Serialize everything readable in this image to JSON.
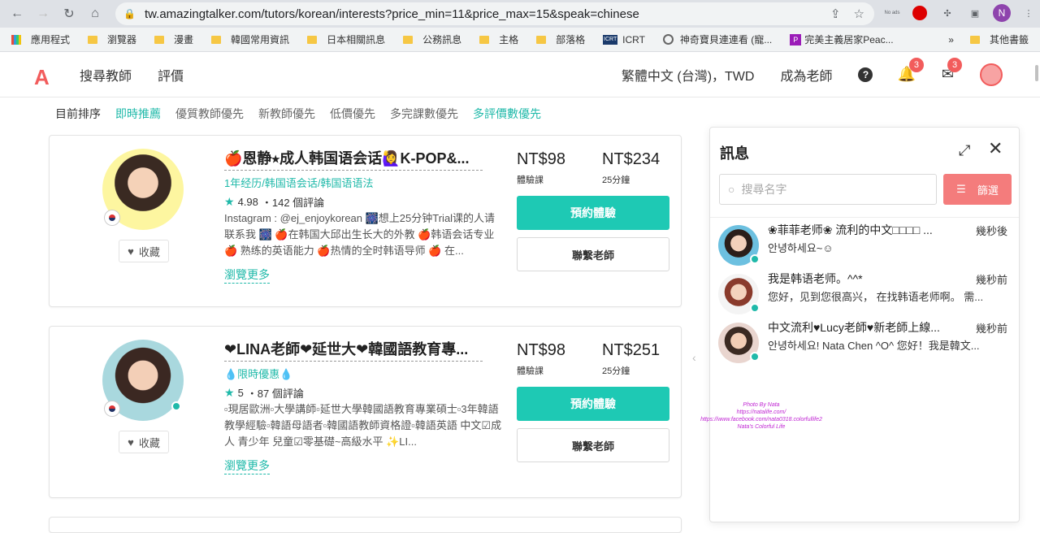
{
  "browser": {
    "url": "tw.amazingtalker.com/tutors/korean/interests?price_min=11&price_max=15&speak=chinese",
    "profile_initial": "N",
    "ext_label": "No ads"
  },
  "bookmarks": {
    "items": [
      "應用程式",
      "瀏覽器",
      "漫畫",
      "韓國常用資訊",
      "日本相關訊息",
      "公務訊息",
      "主格",
      "部落格",
      "ICRT",
      "神奇寶貝連連看 (寵...",
      "完美主義居家Peac..."
    ],
    "more": "»",
    "other": "其他書籤"
  },
  "header": {
    "logo": "A",
    "nav": [
      "搜尋教師",
      "評價"
    ],
    "language": "繁體中文 (台灣)，TWD",
    "become_teacher": "成為老師",
    "help": "?",
    "notif_count": "3",
    "mail_count": "3"
  },
  "sort": {
    "label": "目前排序",
    "options": [
      "即時推薦",
      "優質教師優先",
      "新教師優先",
      "低價優先",
      "多完課數優先",
      "多評價數優先"
    ]
  },
  "tutors": [
    {
      "name": "🍎恩静⭑成人韩国语会话🙋‍♀K-POP&...",
      "tag": "1年经历/韩国语会话/韩国语语法",
      "rating": "4.98",
      "reviews": "・142 個評論",
      "desc": "Instagram : @ej_enjoykorean 🎆想上25分钟Trial课的人请联系我 🎆 🍎在韩国大邱出生长大的外教 🍎韩语会话专业 🍎 熟练的英语能力 🍎热情的全时韩语导师 🍎 在...",
      "more": "瀏覽更多",
      "trial_price": "NT$98",
      "trial_label": "體驗課",
      "price": "NT$234",
      "price_label": "25分鐘",
      "book": "預約體驗",
      "contact": "聯繫老師",
      "fav": "收藏"
    },
    {
      "name": "❤LINA老師❤延世大❤韓國語教育專...",
      "tag": "💧限時優惠💧",
      "rating": "5",
      "reviews": "・87 個評論",
      "desc": "▫現居歐洲▫大學講師▫延世大學韓國語教育專業碩士▫3年韓語教學經驗▫韓語母語者▫韓國語教師資格證▫韓語英語 中文☑成人 青少年 兒童☑零基礎~高級水平 ✨LI...",
      "more": "瀏覽更多",
      "trial_price": "NT$98",
      "trial_label": "體驗課",
      "price": "NT$251",
      "price_label": "25分鐘",
      "book": "預約體驗",
      "contact": "聯繫老師",
      "fav": "收藏"
    }
  ],
  "messages": {
    "title": "訊息",
    "search_placeholder": "搜尋名字",
    "filter": "篩選",
    "items": [
      {
        "name": "❀菲菲老师❀ 流利的中文□□□□ ...",
        "time": "幾秒後",
        "preview": "안녕하세요~☺"
      },
      {
        "name": "我是韩语老师。^^*",
        "time": "幾秒前",
        "preview": "您好，见到您很高兴， 在找韩语老师啊。 需..."
      },
      {
        "name": "中文流利♥Lucy老師♥新老師上線...",
        "time": "幾秒前",
        "preview": "안녕하세요! Nata Chen ^O^ 您好！我是韓文..."
      }
    ]
  },
  "watermark": {
    "lines": [
      "Photo By Nata",
      "https://natalife.com/",
      "https://www.facebook.com/nata0318.colorfullife2",
      "Nata's Colorful Life"
    ]
  }
}
